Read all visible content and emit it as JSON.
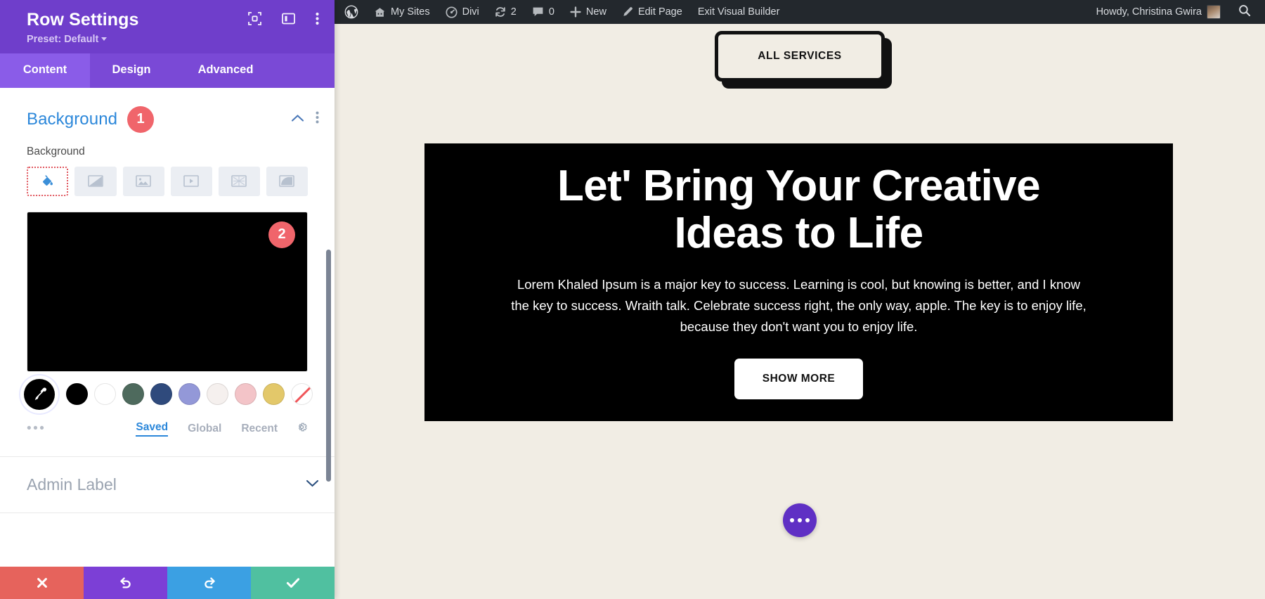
{
  "panel": {
    "title": "Row Settings",
    "preset_label": "Preset: Default",
    "header_icons": [
      {
        "name": "focus-icon"
      },
      {
        "name": "layout-panel-icon"
      },
      {
        "name": "more-vertical-icon"
      }
    ],
    "tabs": [
      {
        "label": "Content",
        "active": true
      },
      {
        "label": "Design",
        "active": false
      },
      {
        "label": "Advanced",
        "active": false
      }
    ],
    "toggle": {
      "title": "Background",
      "badge": "1",
      "collapse_icon": "chevron-up-icon",
      "menu_icon": "more-vertical-icon"
    },
    "background_field": {
      "label": "Background",
      "types": [
        {
          "name": "background-color-icon",
          "active": true
        },
        {
          "name": "background-gradient-icon",
          "active": false
        },
        {
          "name": "background-image-icon",
          "active": false
        },
        {
          "name": "background-video-icon",
          "active": false
        },
        {
          "name": "background-pattern-icon",
          "active": false
        },
        {
          "name": "background-mask-icon",
          "active": false
        }
      ],
      "preview_color": "#000000",
      "preview_badge": "2"
    },
    "swatches": {
      "eyedropper_icon": "eyedropper-icon",
      "colors": [
        "#000000",
        "#ffffff",
        "#4e6a5d",
        "#2f4a7c",
        "#9398d8",
        "#f5f0ee",
        "#f3c4c8",
        "#e3c86a"
      ],
      "transparent_label": "none"
    },
    "color_meta": {
      "more_icon": "more-horizontal-icon",
      "links": [
        {
          "label": "Saved",
          "active": true
        },
        {
          "label": "Global",
          "active": false
        },
        {
          "label": "Recent",
          "active": false
        }
      ],
      "settings_icon": "gear-icon"
    },
    "admin_label": {
      "label": "Admin Label",
      "expand_icon": "chevron-down-icon"
    },
    "footer": [
      {
        "name": "cancel-button",
        "icon": "close-icon",
        "color": "#e6635c"
      },
      {
        "name": "undo-button",
        "icon": "undo-icon",
        "color": "#7c3fd6"
      },
      {
        "name": "redo-button",
        "icon": "redo-icon",
        "color": "#3ba0e3"
      },
      {
        "name": "save-button",
        "icon": "check-icon",
        "color": "#50c0a0"
      }
    ]
  },
  "adminbar": {
    "wp_logo": "wordpress-logo-icon",
    "my_sites": "My Sites",
    "divi": "Divi",
    "updates_count": "2",
    "comments_count": "0",
    "new_label": "New",
    "edit_page": "Edit Page",
    "exit_builder": "Exit Visual Builder",
    "howdy": "Howdy, Christina Gwira",
    "search_icon": "search-icon"
  },
  "canvas": {
    "all_services_button": "ALL SERVICES",
    "hero": {
      "heading": "Let' Bring Your Creative Ideas to Life",
      "paragraph": "Lorem Khaled Ipsum is a major key to success. Learning is cool, but knowing is better, and I know the key to success. Wraith talk. Celebrate success right, the only way, apple. The key is to enjoy life, because they don't want you to enjoy life.",
      "cta_label": "SHOW MORE",
      "background_color": "#000000"
    },
    "fab_icon": "more-horizontal-icon",
    "page_background": "#f1ede4"
  }
}
